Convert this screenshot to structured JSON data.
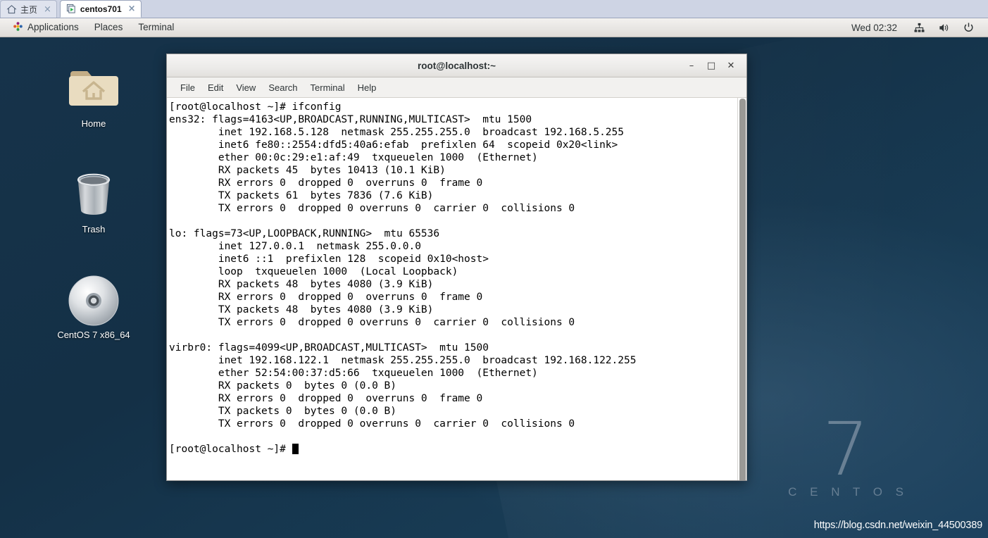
{
  "vmware_tabs": [
    {
      "label": "主页",
      "icon": "home-icon",
      "active": false,
      "close": "×"
    },
    {
      "label": "centos701",
      "icon": "virtual-machine-icon",
      "active": true,
      "close": "×"
    }
  ],
  "panel": {
    "applications": "Applications",
    "places": "Places",
    "terminal": "Terminal",
    "clock": "Wed 02:32",
    "tray": [
      "network-icon",
      "volume-icon",
      "power-icon"
    ],
    "app_menu_icon": "centos-applications-icon"
  },
  "desktop": {
    "icons": [
      {
        "name": "home-folder",
        "label": "Home",
        "icon": "folder-home-icon"
      },
      {
        "name": "trash",
        "label": "Trash",
        "icon": "trash-can-icon"
      },
      {
        "name": "centos-disc",
        "label": "CentOS 7 x86_64",
        "icon": "optical-disc-icon"
      }
    ],
    "watermark_number": "7",
    "watermark_word": "C E N T O S",
    "blog_url": "https://blog.csdn.net/weixin_44500389"
  },
  "terminal": {
    "title": "root@localhost:~",
    "window_buttons": {
      "minimize": "–",
      "maximize": "□",
      "close": "✕"
    },
    "menu": [
      "File",
      "Edit",
      "View",
      "Search",
      "Terminal",
      "Help"
    ],
    "content": "[root@localhost ~]# ifconfig\nens32: flags=4163<UP,BROADCAST,RUNNING,MULTICAST>  mtu 1500\n        inet 192.168.5.128  netmask 255.255.255.0  broadcast 192.168.5.255\n        inet6 fe80::2554:dfd5:40a6:efab  prefixlen 64  scopeid 0x20<link>\n        ether 00:0c:29:e1:af:49  txqueuelen 1000  (Ethernet)\n        RX packets 45  bytes 10413 (10.1 KiB)\n        RX errors 0  dropped 0  overruns 0  frame 0\n        TX packets 61  bytes 7836 (7.6 KiB)\n        TX errors 0  dropped 0 overruns 0  carrier 0  collisions 0\n\nlo: flags=73<UP,LOOPBACK,RUNNING>  mtu 65536\n        inet 127.0.0.1  netmask 255.0.0.0\n        inet6 ::1  prefixlen 128  scopeid 0x10<host>\n        loop  txqueuelen 1000  (Local Loopback)\n        RX packets 48  bytes 4080 (3.9 KiB)\n        RX errors 0  dropped 0  overruns 0  frame 0\n        TX packets 48  bytes 4080 (3.9 KiB)\n        TX errors 0  dropped 0 overruns 0  carrier 0  collisions 0\n\nvirbr0: flags=4099<UP,BROADCAST,MULTICAST>  mtu 1500\n        inet 192.168.122.1  netmask 255.255.255.0  broadcast 192.168.122.255\n        ether 52:54:00:37:d5:66  txqueuelen 1000  (Ethernet)\n        RX packets 0  bytes 0 (0.0 B)\n        RX errors 0  dropped 0  overruns 0  frame 0\n        TX packets 0  bytes 0 (0.0 B)\n        TX errors 0  dropped 0 overruns 0  carrier 0  collisions 0\n\n",
    "prompt": "[root@localhost ~]# "
  },
  "colors": {
    "desktop_bg": "#143046",
    "tabstrip_bg": "#ced4e4",
    "panel_bg": "#ecebe9",
    "terminal_bg": "#ffffff",
    "terminal_fg": "#000000"
  }
}
